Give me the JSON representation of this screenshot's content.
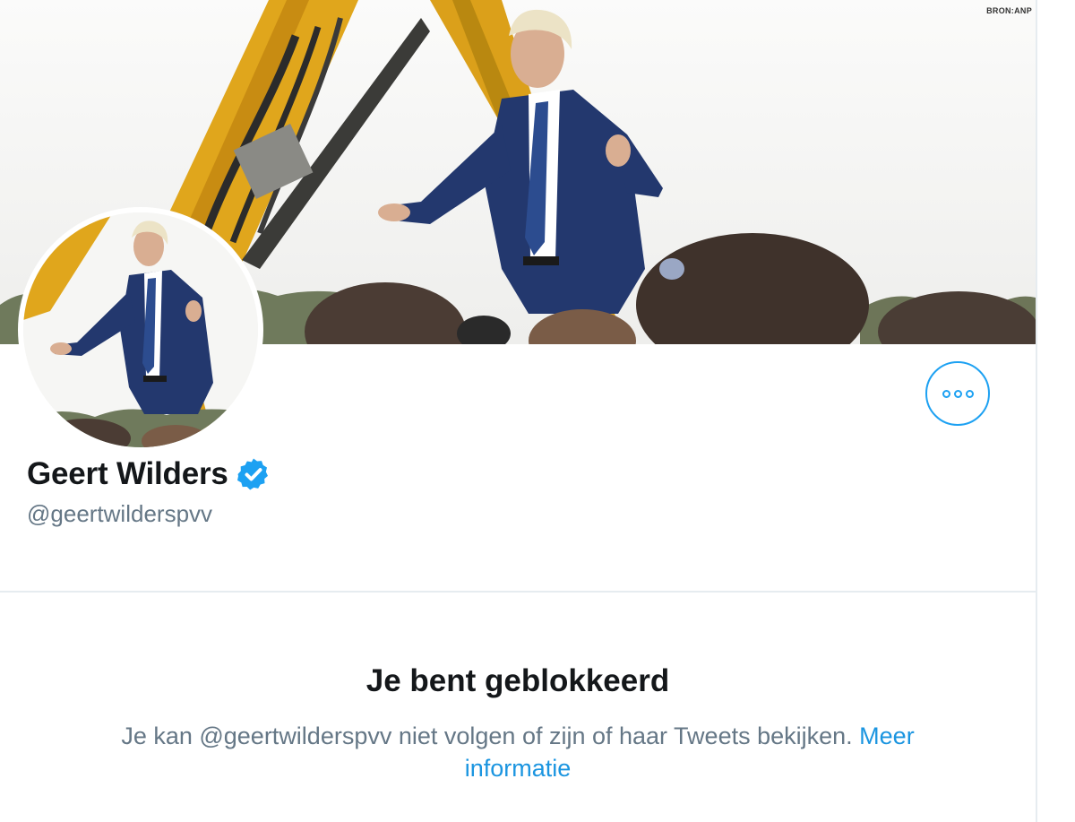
{
  "banner": {
    "photo_credit": "BRON:ANP"
  },
  "profile": {
    "display_name": "Geert Wilders",
    "handle": "@geertwilderspvv",
    "verified": true
  },
  "blocked_notice": {
    "title": "Je bent geblokkeerd",
    "message": "Je kan @geertwilderspvv niet volgen of zijn of haar Tweets bekijken.",
    "link_text": "Meer informatie"
  },
  "icons": {
    "more": "more-options-icon",
    "verified": "verified-badge-icon"
  },
  "colors": {
    "accent": "#1da1f2",
    "link": "#1b95e0",
    "text_primary": "#14171a",
    "text_secondary": "#657786",
    "divider": "#e6ecf0"
  }
}
